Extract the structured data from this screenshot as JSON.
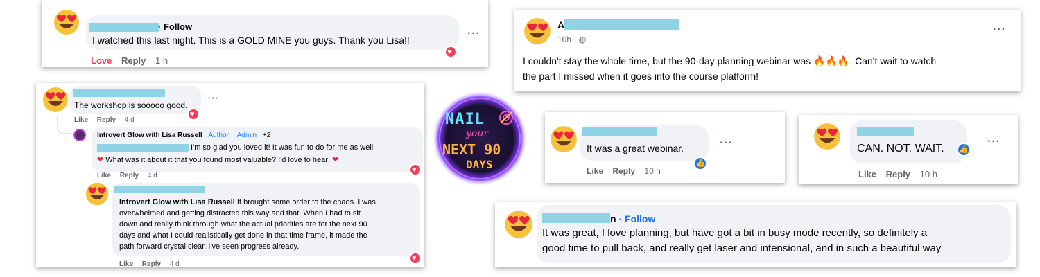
{
  "comment1": {
    "follow": "Follow",
    "text": "I watched this last night. This is a GOLD MINE you guys. Thank you Lisa!!",
    "love": "Love",
    "reply": "Reply",
    "time": "1 h",
    "more": "···"
  },
  "comment2": {
    "text": "The workshop is sooooo good.",
    "like": "Like",
    "reply": "Reply",
    "time": "4 d",
    "more": "···",
    "reply1": {
      "author": "Introvert Glow with Lisa Russell",
      "tag_author": "Author",
      "tag_admin": "Admin",
      "tag_more": "+2",
      "text_line1": " I'm so glad you loved it! It was fun to do for me as well",
      "text_line2": " What was it about it that you found most valuable? I'd love to hear! ",
      "like": "Like",
      "reply": "Reply",
      "time": "4 d"
    },
    "reply2": {
      "mention": "Introvert Glow with Lisa Russell",
      "lines": [
        " It brought some order to the chaos. I was",
        "overwhelmed and getting distracted this way and that. When I had to sit",
        "down and really think through what the actual priorities are for the next 90",
        "days and what I could realistically get done in that time frame, it made the",
        "path forward crystal clear. I've seen progress already."
      ],
      "like": "Like",
      "reply": "Reply",
      "time": "4 d"
    }
  },
  "logo": {
    "line1": "NAIL",
    "line2": "your",
    "line3": "NEXT 90",
    "line4": "DAYS"
  },
  "post": {
    "initial": "A",
    "time": "10h · ",
    "more": "···",
    "text_part1": "I couldn't stay the whole time, but the 90-day planning webinar was ",
    "fire": "🔥🔥🔥",
    "text_part2": ". Can't wait to watch",
    "text_line2": "the part I missed when it goes into the course platform!"
  },
  "comment3": {
    "text": "It was a great webinar.",
    "like": "Like",
    "reply": "Reply",
    "time": "10 h",
    "more": "···"
  },
  "comment4": {
    "text": "CAN. NOT. WAIT.",
    "like": "Like",
    "reply": "Reply",
    "time": "10 h",
    "more": "···"
  },
  "comment5": {
    "name_end": "n",
    "follow": "Follow",
    "line1": "It was great, I love planning, but have got a bit in busy mode recently, so definitely a",
    "line2": "good time to pull back, and really get laser and intensional, and in such a beautiful way"
  },
  "colors": {
    "accent": "#1877f2",
    "love": "#f33e58",
    "redaction": "#8fd4e6",
    "bubble": "#f0f2f5"
  }
}
